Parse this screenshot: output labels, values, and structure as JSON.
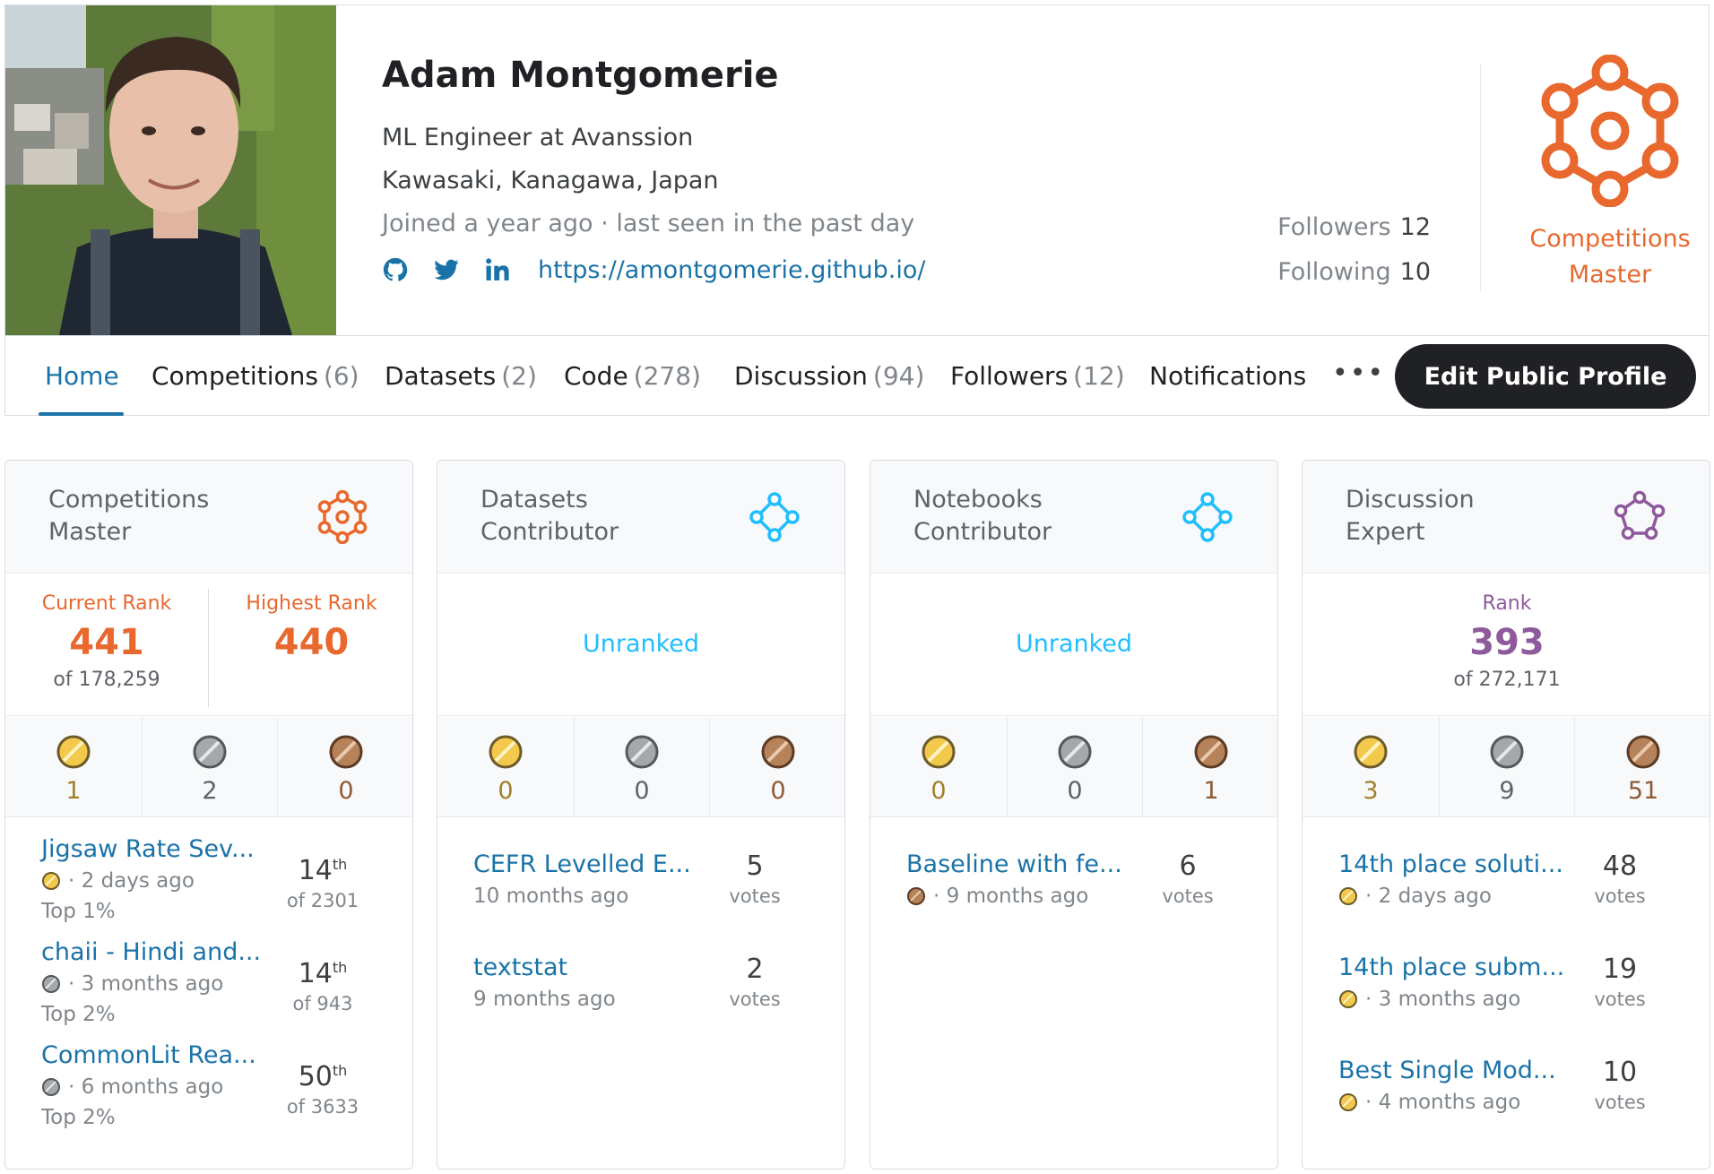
{
  "profile": {
    "name": "Adam Montgomerie",
    "occupation": "ML Engineer at Avanssion",
    "location": "Kawasaki, Kanagawa, Japan",
    "joined": "Joined a year ago · last seen in the past day",
    "website": "https://amontgomerie.github.io/",
    "social_icons": [
      "github-icon",
      "twitter-icon",
      "linkedin-icon"
    ],
    "followers_label": "Followers",
    "followers_count": "12",
    "following_label": "Following",
    "following_count": "10",
    "tier": "Competitions Master"
  },
  "tabs": {
    "home": "Home",
    "competitions": "Competitions",
    "competitions_count": "(6)",
    "datasets": "Datasets",
    "datasets_count": "(2)",
    "code": "Code",
    "code_count": "(278)",
    "discussion": "Discussion",
    "discussion_count": "(94)",
    "followers": "Followers",
    "followers_count": "(12)",
    "notifications": "Notifications",
    "more": "•••",
    "edit_button": "Edit Public Profile"
  },
  "colors": {
    "competitions_accent": "#e8682e",
    "unranked_accent": "#20beff",
    "discussion_accent": "#8e5a9c",
    "link": "#1a73a8",
    "gold": "#f2c94c",
    "silver": "#a5a8ab",
    "bronze": "#b5825a"
  },
  "cards": [
    {
      "title": "Competitions Master",
      "icon": "competitions-master-icon",
      "current_rank_label": "Current Rank",
      "current_rank": "441",
      "current_rank_of": "of 178,259",
      "highest_rank_label": "Highest Rank",
      "highest_rank": "440",
      "medals": {
        "gold": "1",
        "silver": "2",
        "bronze": "0"
      },
      "items": [
        {
          "title": "Jigsaw Rate Sev...",
          "medal": "gold",
          "time": "· 2 days ago",
          "top": "Top 1%",
          "rank": "14",
          "suffix": "th",
          "of": "of 2301"
        },
        {
          "title": "chaii - Hindi and...",
          "medal": "silver",
          "time": "· 3 months ago",
          "top": "Top 2%",
          "rank": "14",
          "suffix": "th",
          "of": "of 943"
        },
        {
          "title": "CommonLit Rea...",
          "medal": "silver",
          "time": "· 6 months ago",
          "top": "Top 2%",
          "rank": "50",
          "suffix": "th",
          "of": "of 3633"
        }
      ]
    },
    {
      "title": "Datasets Contributor",
      "icon": "datasets-contributor-icon",
      "unranked": "Unranked",
      "medals": {
        "gold": "0",
        "silver": "0",
        "bronze": "0"
      },
      "items": [
        {
          "title": "CEFR Levelled E...",
          "time": "10 months ago",
          "votes": "5",
          "votes_label": "votes"
        },
        {
          "title": "textstat",
          "time": "9 months ago",
          "votes": "2",
          "votes_label": "votes"
        }
      ]
    },
    {
      "title": "Notebooks Contributor",
      "icon": "notebooks-contributor-icon",
      "unranked": "Unranked",
      "medals": {
        "gold": "0",
        "silver": "0",
        "bronze": "1"
      },
      "items": [
        {
          "title": "Baseline with fe...",
          "medal": "bronze",
          "time": "· 9 months ago",
          "votes": "6",
          "votes_label": "votes"
        }
      ]
    },
    {
      "title": "Discussion Expert",
      "icon": "discussion-expert-icon",
      "rank_label": "Rank",
      "rank": "393",
      "rank_of": "of 272,171",
      "medals": {
        "gold": "3",
        "silver": "9",
        "bronze": "51"
      },
      "items": [
        {
          "title": "14th place soluti...",
          "medal": "gold",
          "time": "· 2 days ago",
          "votes": "48",
          "votes_label": "votes"
        },
        {
          "title": "14th place subm...",
          "medal": "gold",
          "time": "· 3 months ago",
          "votes": "19",
          "votes_label": "votes"
        },
        {
          "title": "Best Single Mod...",
          "medal": "gold",
          "time": "· 4 months ago",
          "votes": "10",
          "votes_label": "votes"
        }
      ]
    }
  ]
}
